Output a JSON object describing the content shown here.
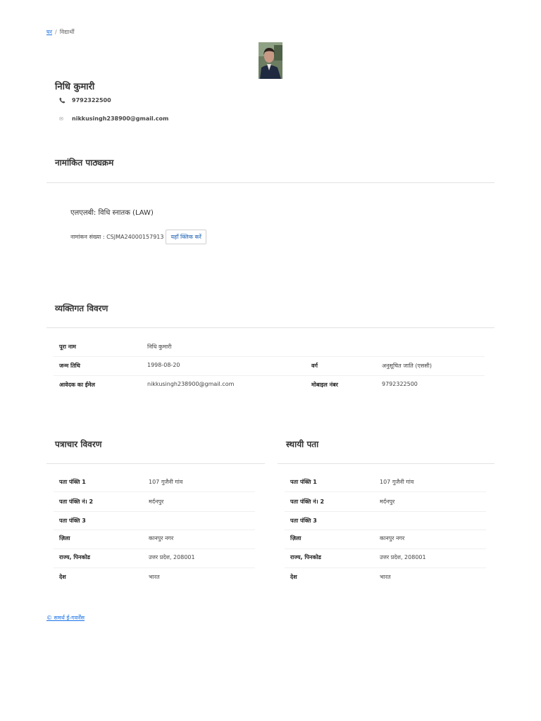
{
  "breadcrumb": {
    "home": "घर",
    "separator": "/",
    "current": "विद्यार्थी"
  },
  "profile": {
    "name": "निधि कुमारी",
    "phone": "9792322500",
    "email": "nikkusingh238900@gmail.com"
  },
  "enrolled": {
    "title": "नामांकित पाठ्यक्रम",
    "course": "एलएलबी: विधि स्नातक (LAW)",
    "enrollment_label": "नामांकन संख्या : CSJMA24000157913",
    "click_button": "यहाँ क्लिक करें"
  },
  "personal": {
    "title": "व्यक्तिगत विवरण",
    "full_name_label": "पूरा नाम",
    "full_name": "निधि कुमारी",
    "dob_label": "जन्म तिथि",
    "dob": "1998-08-20",
    "category_label": "वर्ग",
    "category": "अनुसूचित जाति (एससी)",
    "email_label": "आवेदक का ईमेल",
    "email": "nikkusingh238900@gmail.com",
    "mobile_label": "मोबाइल नंबर",
    "mobile": "9792322500"
  },
  "correspondence": {
    "title": "पत्राचार विवरण",
    "rows": [
      {
        "label": "पता पंक्ति 1",
        "value": "107 गुजैनी गांव"
      },
      {
        "label": "पता पंक्ति नं। 2",
        "value": "मर्दनपुर"
      },
      {
        "label": "पता पंक्ति 3",
        "value": ""
      },
      {
        "label": "ज़िला",
        "value": "कानपुर नगर"
      },
      {
        "label": "राज्य, पिनकोड",
        "value": "उत्तर प्रदेश, 208001"
      },
      {
        "label": "देश",
        "value": "भारत"
      }
    ]
  },
  "permanent": {
    "title": "स्थायी पता",
    "rows": [
      {
        "label": "पता पंक्ति 1",
        "value": "107 गुजैनी गांव"
      },
      {
        "label": "पता पंक्ति नं। 2",
        "value": "मर्दनपुर"
      },
      {
        "label": "पता पंक्ति 3",
        "value": ""
      },
      {
        "label": "ज़िला",
        "value": "कानपुर नगर"
      },
      {
        "label": "राज्य, पिनकोड",
        "value": "उत्तर प्रदेश, 208001"
      },
      {
        "label": "देश",
        "value": "भारत"
      }
    ]
  },
  "footer": {
    "text": "© समर्थ ई-गवर्नेंस"
  }
}
